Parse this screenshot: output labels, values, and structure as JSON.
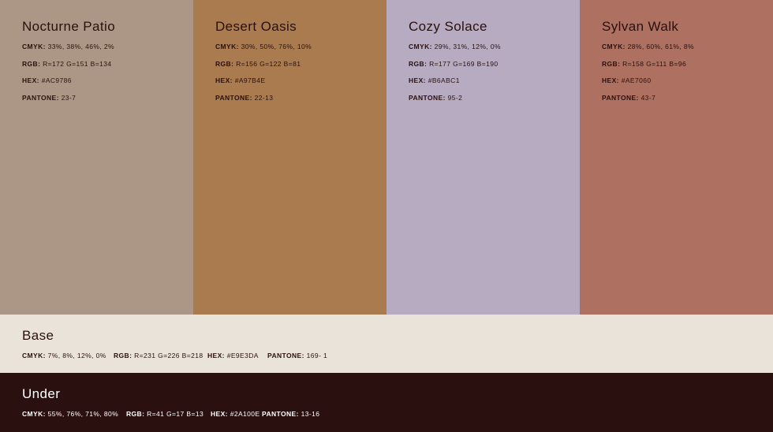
{
  "colors": [
    {
      "name": "Nocturne Patio",
      "bg": "#AC9786",
      "cmyk_label": "CMYK:",
      "cmyk": "33%, 38%, 46%, 2%",
      "rgb_label": "RGB:",
      "rgb": "R=172 G=151 B=134",
      "hex_label": "HEX:",
      "hex": "#AC9786",
      "pantone_label": "PANTONE:",
      "pantone": "23-7"
    },
    {
      "name": "Desert Oasis",
      "bg": "#A97B4E",
      "cmyk_label": "CMYK:",
      "cmyk": "30%, 50%, 76%, 10%",
      "rgb_label": "RGB:",
      "rgb": "R=156 G=122 B=81",
      "hex_label": "HEX:",
      "hex": "#A97B4E",
      "pantone_label": "PANTONE:",
      "pantone": "22-13"
    },
    {
      "name": "Cozy Solace",
      "bg": "#B6ABC1",
      "cmyk_label": "CMYK:",
      "cmyk": "29%, 31%, 12%, 0%",
      "rgb_label": "RGB:",
      "rgb": "R=177 G=169 B=190",
      "hex_label": "HEX:",
      "hex": "#B6ABC1",
      "pantone_label": "PANTONE:",
      "pantone": "95-2"
    },
    {
      "name": "Sylvan Walk",
      "bg": "#AE7060",
      "cmyk_label": "CMYK:",
      "cmyk": "28%, 60%, 61%, 8%",
      "rgb_label": "RGB:",
      "rgb": "R=158 G=111 B=96",
      "hex_label": "HEX:",
      "hex": "#AE7060",
      "pantone_label": "PANTONE:",
      "pantone": "43-7"
    }
  ],
  "base": {
    "name": "Base",
    "bg": "#E9E3DA",
    "cmyk_label": "CMYK:",
    "cmyk": "7%, 8%, 12%, 0%",
    "rgb_label": "RGB:",
    "rgb": "R=231 G=226 B=218",
    "hex_label": "HEX:",
    "hex": "#E9E3DA",
    "pantone_label": "PANTONE:",
    "pantone": "169- 1"
  },
  "under": {
    "name": "Under",
    "bg": "#2A100E",
    "cmyk_label": "CMYK:",
    "cmyk": "55%, 76%, 71%, 80%",
    "rgb_label": "RGB:",
    "rgb": "R=41 G=17 B=13",
    "hex_label": "HEX:",
    "hex": "#2A100E",
    "pantone_label": "PANTONE:",
    "pantone": "13-16"
  }
}
